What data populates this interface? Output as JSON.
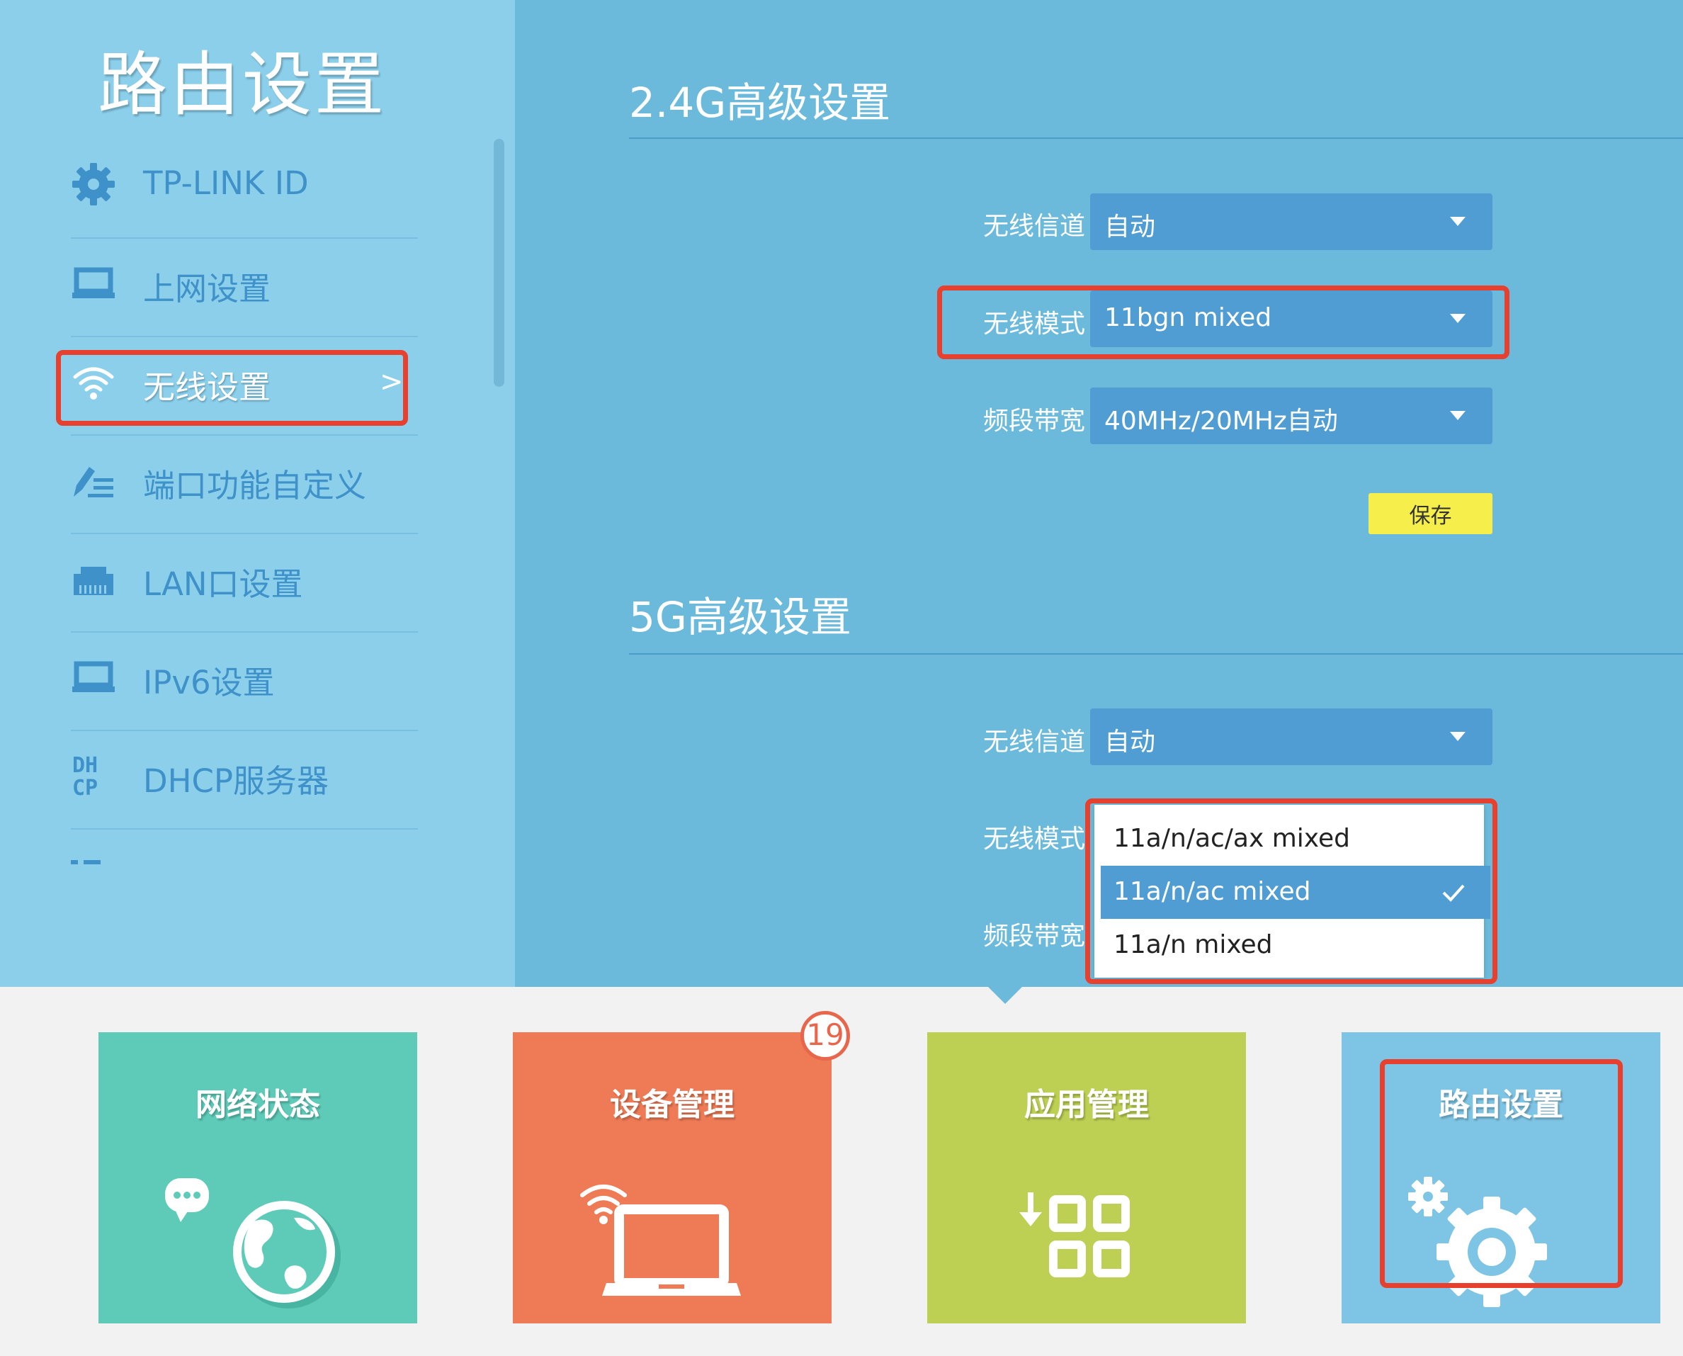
{
  "sidebar": {
    "title": "路由设置",
    "items": [
      {
        "label": "TP-LINK ID",
        "icon": "gear-icon"
      },
      {
        "label": "上网设置",
        "icon": "monitor-icon"
      },
      {
        "label": "无线设置",
        "icon": "wifi-icon",
        "active": true,
        "chevron": ">"
      },
      {
        "label": "端口功能自定义",
        "icon": "pen-list-icon"
      },
      {
        "label": "LAN口设置",
        "icon": "lan-port-icon"
      },
      {
        "label": "IPv6设置",
        "icon": "monitor-icon"
      },
      {
        "label": "DHCP服务器",
        "icon": "dhcp-icon"
      }
    ]
  },
  "section24": {
    "title": "2.4G高级设置",
    "channel": {
      "label": "无线信道",
      "value": "自动"
    },
    "mode": {
      "label": "无线模式",
      "value": "11bgn mixed"
    },
    "bandwidth": {
      "label": "频段带宽",
      "value": "40MHz/20MHz自动"
    },
    "save": "保存"
  },
  "section5": {
    "title": "5G高级设置",
    "channel": {
      "label": "无线信道",
      "value": "自动"
    },
    "mode": {
      "label": "无线模式",
      "options": [
        "11a/n/ac/ax mixed",
        "11a/n/ac mixed",
        "11a/n mixed"
      ],
      "selected": "11a/n/ac mixed"
    },
    "bandwidth": {
      "label": "频段带宽"
    }
  },
  "tiles": [
    {
      "label": "网络状态",
      "color": "#5ecbb9",
      "icon": "globe-chat-icon"
    },
    {
      "label": "设备管理",
      "color": "#ee7b55",
      "icon": "laptop-wifi-icon",
      "badge": "19"
    },
    {
      "label": "应用管理",
      "color": "#bdd053",
      "icon": "apps-grid-icon"
    },
    {
      "label": "路由设置",
      "color": "#7ec4e4",
      "icon": "gears-icon",
      "active": true
    }
  ],
  "colors": {
    "sidebar_bg": "#8bcfeb",
    "main_bg": "#6bbadc",
    "select_bg": "#4f9dd3",
    "highlight": "#e8402f",
    "save_button": "#f5ee4b"
  }
}
